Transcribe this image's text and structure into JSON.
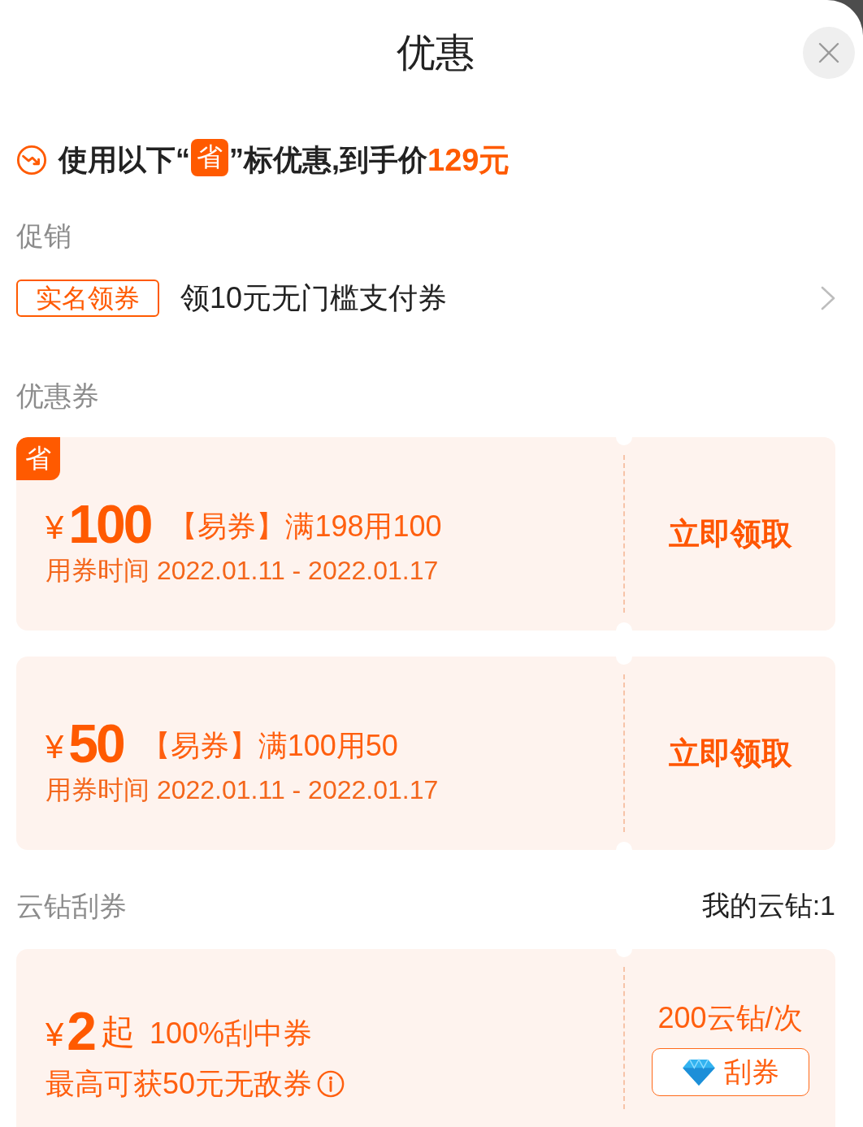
{
  "sheet": {
    "title": "优惠"
  },
  "headline": {
    "text_before": "使用以下“",
    "badge": "省",
    "text_after": "”标优惠,到手价",
    "price": "129元"
  },
  "promotions": {
    "heading": "促销",
    "items": [
      {
        "tag": "实名领券",
        "text": "领10元无门槛支付券"
      }
    ]
  },
  "coupons": {
    "heading": "优惠券",
    "items": [
      {
        "saving_badge": "省",
        "currency": "¥",
        "amount": "100",
        "label": "【易券】满198用100",
        "validity": "用券时间 2022.01.11 - 2022.01.17",
        "action": "立即领取"
      },
      {
        "currency": "¥",
        "amount": "50",
        "label": "【易券】满100用50",
        "validity": "用券时间 2022.01.11 - 2022.01.17",
        "action": "立即领取"
      }
    ]
  },
  "scratch": {
    "heading": "云钻刮券",
    "balance": "我的云钻:1",
    "items": [
      {
        "currency": "¥",
        "amount": "2",
        "suffix": "起",
        "label": "100%刮中券",
        "detail": "最高可获50元无敌券",
        "price": "200云钻/次",
        "action": "刮券"
      }
    ]
  }
}
